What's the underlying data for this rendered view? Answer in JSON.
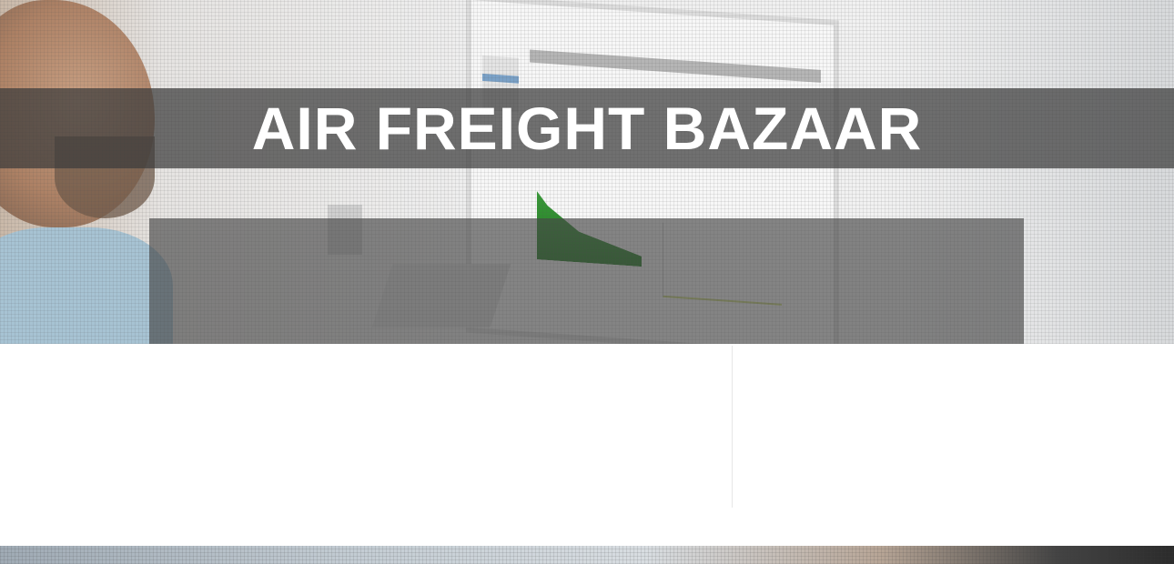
{
  "hero": {
    "title": "AIR FREIGHT BAZAAR"
  }
}
